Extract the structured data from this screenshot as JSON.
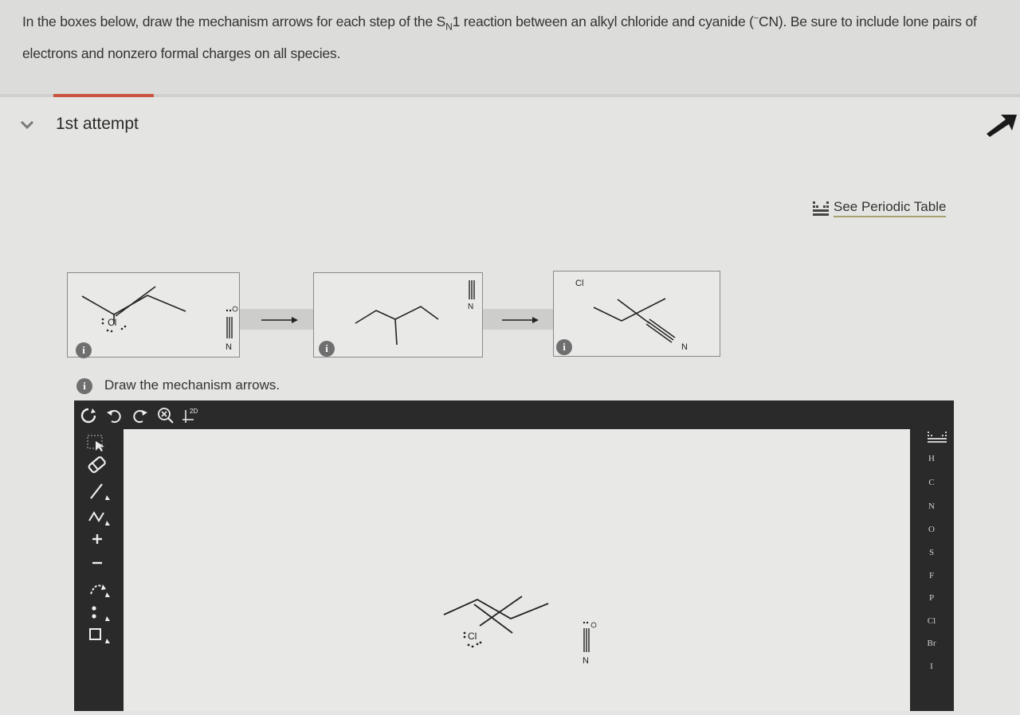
{
  "question": {
    "text_part1": "In the boxes below, draw the mechanism arrows for each step of the S",
    "subscript": "N",
    "text_part2": "1 reaction between an alkyl chloride and cyanide (",
    "superscript": "−",
    "text_part3": "CN). Be sure to include lone pairs of electrons and nonzero formal charges on all species."
  },
  "attempt": {
    "label": "1st attempt"
  },
  "periodic_table": {
    "label": "See Periodic Table"
  },
  "scheme": {
    "info_glyph": "i",
    "box1": {
      "cl_label": "Cl",
      "n_label": "N"
    },
    "box2": {
      "n_label": "N"
    },
    "box3": {
      "cl_label": "Cl",
      "n_label": "N"
    }
  },
  "instruction": {
    "label": "Draw the mechanism arrows.",
    "info_glyph": "i"
  },
  "toolbar": {
    "template_label": "2D"
  },
  "canvas": {
    "cl_label": "Cl",
    "n_label": "N"
  },
  "elements": [
    "H",
    "C",
    "N",
    "O",
    "S",
    "F",
    "P",
    "Cl",
    "Br",
    "I"
  ],
  "colors": {
    "accent_tab": "#c9553e",
    "toolbar_bg": "#2a2a2a"
  }
}
